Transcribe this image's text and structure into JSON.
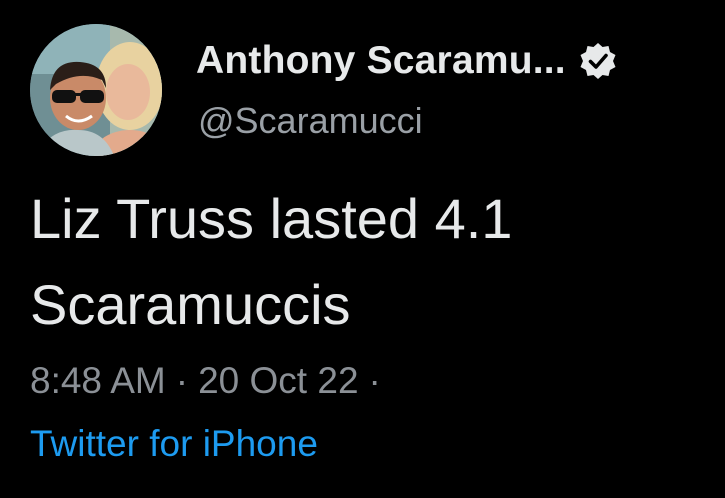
{
  "author": {
    "display_name": "Anthony Scaramu...",
    "handle": "@Scaramucci",
    "verified": true,
    "avatar_icon": "profile-photo-avatar",
    "verified_icon": "verified-badge-icon"
  },
  "tweet": {
    "text": "Liz Truss lasted 4.1 Scaramuccis",
    "time": "8:48 AM",
    "date": "20 Oct 22",
    "separator": "·",
    "source": "Twitter for iPhone"
  },
  "colors": {
    "background": "#000000",
    "text": "#e7e9ea",
    "secondary_text": "#8b9096",
    "link": "#1d9bf0",
    "verified_badge": "#e7e9ea"
  }
}
